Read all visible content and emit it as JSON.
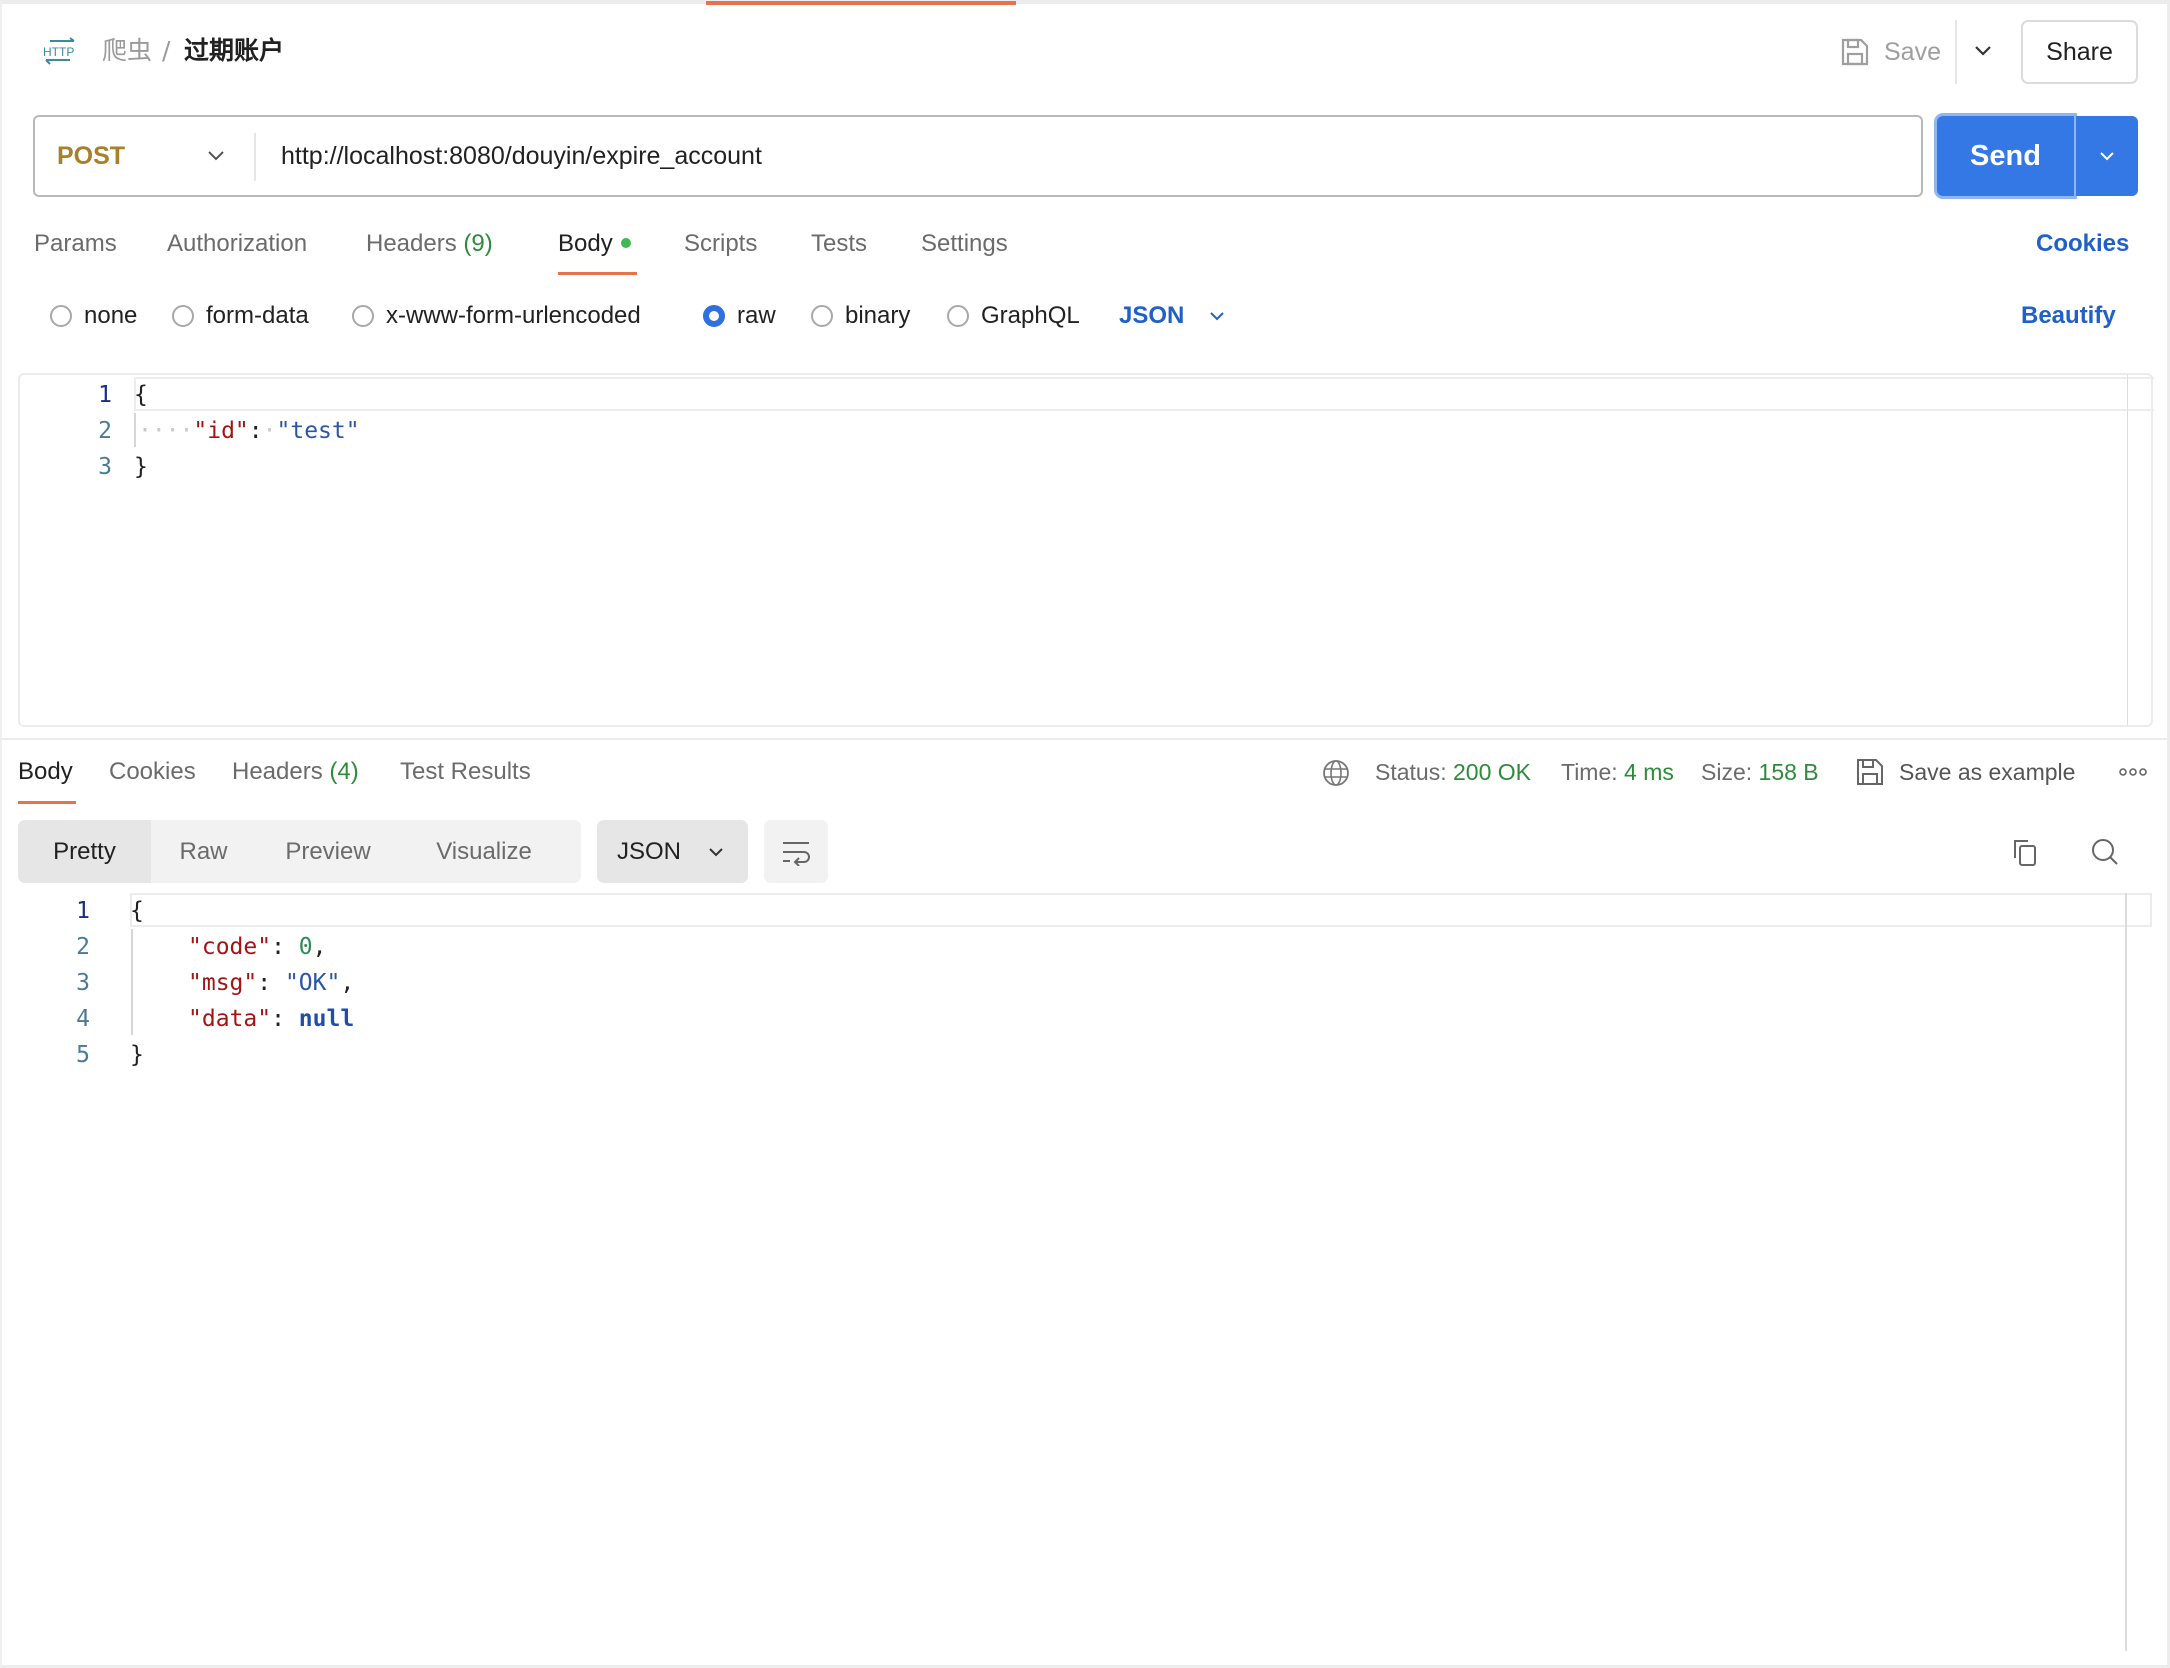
{
  "header": {
    "icon": "http-icon",
    "breadcrumb_parent": "爬虫",
    "breadcrumb_separator": "/",
    "breadcrumb_current": "过期账户",
    "save_label": "Save",
    "share_label": "Share"
  },
  "request": {
    "method": "POST",
    "url": "http://localhost:8080/douyin/expire_account",
    "send_label": "Send"
  },
  "request_tabs": [
    {
      "label": "Params"
    },
    {
      "label": "Authorization"
    },
    {
      "label": "Headers",
      "count": "(9)"
    },
    {
      "label": "Body",
      "active": true,
      "indicator": "green-dot"
    },
    {
      "label": "Scripts"
    },
    {
      "label": "Tests"
    },
    {
      "label": "Settings"
    }
  ],
  "cookies_label": "Cookies",
  "body_types": [
    {
      "label": "none",
      "checked": false
    },
    {
      "label": "form-data",
      "checked": false
    },
    {
      "label": "x-www-form-urlencoded",
      "checked": false
    },
    {
      "label": "raw",
      "checked": true
    },
    {
      "label": "binary",
      "checked": false
    },
    {
      "label": "GraphQL",
      "checked": false
    }
  ],
  "body_format": "JSON",
  "beautify_label": "Beautify",
  "request_body": {
    "line_numbers": [
      "1",
      "2",
      "3"
    ],
    "lines": [
      {
        "open": "{"
      },
      {
        "key": "\"id\"",
        "colon": ":",
        "value": "\"test\""
      },
      {
        "close": "}"
      }
    ]
  },
  "response_tabs": [
    {
      "label": "Body",
      "active": true
    },
    {
      "label": "Cookies"
    },
    {
      "label": "Headers",
      "count": "(4)"
    },
    {
      "label": "Test Results"
    }
  ],
  "response_status": {
    "status_label": "Status:",
    "status_value": "200 OK",
    "time_label": "Time:",
    "time_value": "4 ms",
    "size_label": "Size:",
    "size_value": "158 B",
    "save_example_label": "Save as example",
    "more_icon": "more-icon"
  },
  "response_views": [
    {
      "label": "Pretty",
      "active": true
    },
    {
      "label": "Raw"
    },
    {
      "label": "Preview"
    },
    {
      "label": "Visualize"
    }
  ],
  "response_format": "JSON",
  "response_body": {
    "line_numbers": [
      "1",
      "2",
      "3",
      "4",
      "5"
    ],
    "lines": [
      {
        "open": "{"
      },
      {
        "key": "\"code\"",
        "colon": ": ",
        "value": "0",
        "comma": ","
      },
      {
        "key": "\"msg\"",
        "colon": ": ",
        "value": "\"OK\"",
        "comma": ","
      },
      {
        "key": "\"data\"",
        "colon": ": ",
        "value": "null"
      },
      {
        "close": "}"
      }
    ]
  },
  "colors": {
    "accent_orange": "#e8734a",
    "send_blue": "#3478e5",
    "link_blue": "#2060c8",
    "status_green": "#2e8b3a",
    "method_post": "#a9802a"
  }
}
